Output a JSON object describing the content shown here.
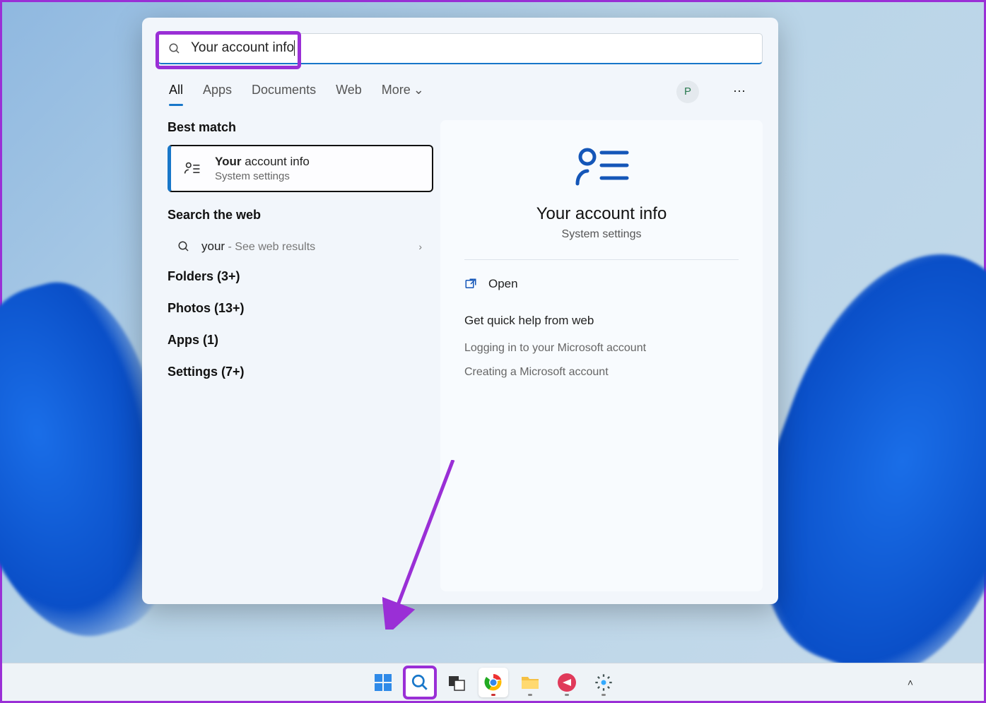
{
  "search": {
    "query": "Your account info"
  },
  "tabs": {
    "all": "All",
    "apps": "Apps",
    "documents": "Documents",
    "web": "Web",
    "more": "More"
  },
  "user_initial": "P",
  "left": {
    "best_match_header": "Best match",
    "best_match": {
      "title_bold": "Your",
      "title_rest": " account info",
      "subtitle": "System settings"
    },
    "search_web_header": "Search the web",
    "web_item": {
      "query": "your",
      "hint": " - See web results"
    },
    "categories": [
      {
        "label": "Folders",
        "count": "(3+)"
      },
      {
        "label": "Photos",
        "count": "(13+)"
      },
      {
        "label": "Apps",
        "count": "(1)"
      },
      {
        "label": "Settings",
        "count": "(7+)"
      }
    ]
  },
  "right": {
    "title": "Your account info",
    "subtitle": "System settings",
    "open_label": "Open",
    "help_header": "Get quick help from web",
    "help_links": [
      "Logging in to your Microsoft account",
      "Creating a Microsoft account"
    ]
  }
}
